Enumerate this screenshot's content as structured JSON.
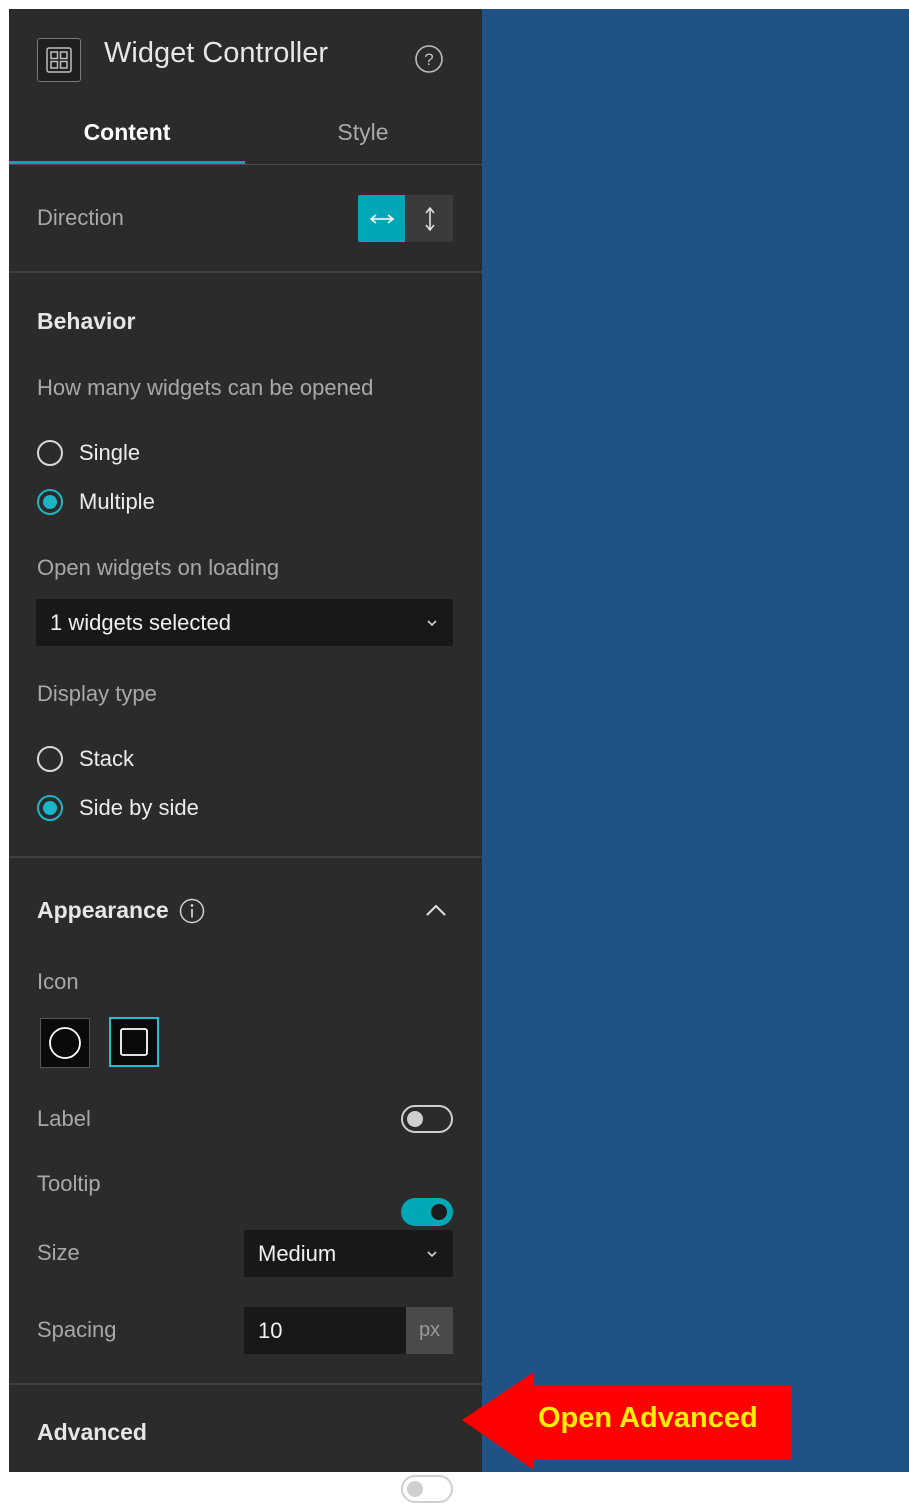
{
  "panel": {
    "title": "Widget Controller",
    "tabs": [
      {
        "label": "Content",
        "active": true
      },
      {
        "label": "Style",
        "active": false
      }
    ],
    "direction": {
      "label": "Direction",
      "selected": "horizontal"
    },
    "behavior": {
      "heading": "Behavior",
      "open_count_label": "How many widgets can be opened",
      "open_count_options": [
        {
          "label": "Single",
          "checked": false
        },
        {
          "label": "Multiple",
          "checked": true
        }
      ],
      "open_on_loading_label": "Open widgets on loading",
      "open_on_loading_value": "1 widgets selected",
      "display_type_label": "Display type",
      "display_type_options": [
        {
          "label": "Stack",
          "checked": false
        },
        {
          "label": "Side by side",
          "checked": true
        }
      ]
    },
    "appearance": {
      "heading": "Appearance",
      "expanded": true,
      "icon_label": "Icon",
      "icon_shapes": [
        "circle",
        "square"
      ],
      "icon_selected": "square",
      "label_label": "Label",
      "label_on": false,
      "tooltip_label": "Tooltip",
      "tooltip_on": true,
      "size_label": "Size",
      "size_value": "Medium",
      "spacing_label": "Spacing",
      "spacing_value": "10",
      "spacing_unit": "px"
    },
    "advanced": {
      "heading": "Advanced",
      "on": false
    }
  },
  "callout": {
    "text": "Open Advanced",
    "text_color": "#ffee00",
    "arrow_color": "#ff0000"
  },
  "colors": {
    "accent": "#00a7b7",
    "panel_bg": "#2b2b2b",
    "canvas_bg": "#215286"
  }
}
